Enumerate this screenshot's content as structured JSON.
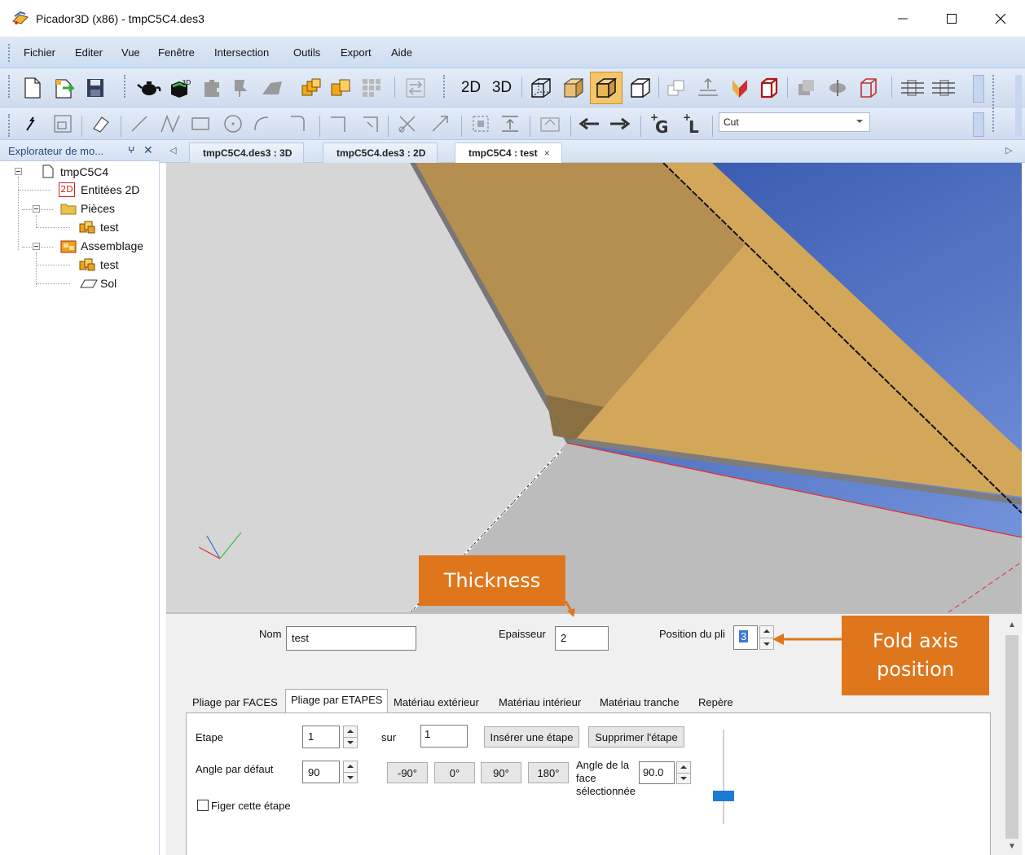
{
  "window": {
    "title": "Picador3D (x86) - tmpC5C4.des3"
  },
  "menu": {
    "items": [
      "Fichier",
      "Editer",
      "Vue",
      "Fenêtre",
      "Intersection",
      "Outils",
      "Export",
      "Aide"
    ]
  },
  "toolbar": {
    "label_2d": "2D",
    "label_3d": "3D",
    "cut_select_value": "Cut"
  },
  "explorer": {
    "title": "Explorateur de mo...",
    "pin": "ⵖ",
    "close": "✕",
    "tree": {
      "root": "tmpC5C4",
      "entities_badge": "2D",
      "entities": "Entitées 2D",
      "pieces": "Pièces",
      "piece_test": "test",
      "assemblage": "Assemblage",
      "assembly_test": "test",
      "sol": "Sol"
    }
  },
  "doc_tabs": {
    "items": [
      "tmpC5C4.des3 : 3D",
      "tmpC5C4.des3 : 2D",
      "tmpC5C4 : test"
    ],
    "active_index": 2,
    "close": "×"
  },
  "properties": {
    "nom_label": "Nom",
    "nom_value": "test",
    "epaisseur_label": "Epaisseur",
    "epaisseur_value": "2",
    "position_label": "Position du pli",
    "position_value": "3",
    "tabs": [
      "Pliage par FACES",
      "Pliage par ETAPES",
      "Matériau extérieur",
      "Matériau intérieur",
      "Matériau tranche",
      "Repère"
    ],
    "active_tab_index": 1,
    "etape_label": "Etape",
    "etape_value": "1",
    "sur_label": "sur",
    "sur_value": "1",
    "insert_button": "Insérer une étape",
    "delete_button": "Supprimer l'étape",
    "angle_defaut_label": "Angle par défaut",
    "angle_defaut_value": "90",
    "angle_buttons": [
      "-90°",
      "0°",
      "90°",
      "180°"
    ],
    "angle_face_label": "Angle de la face sélectionnée",
    "angle_face_value": "90.0",
    "figer_label": "Figer cette étape",
    "figer_checked": false
  },
  "annotations": {
    "thickness": "Thickness",
    "fold_axis": "Fold axis position"
  },
  "colors": {
    "callout": "#e0761c",
    "sheet_tan": "#d3a75a",
    "sheet_dark": "#b48f50",
    "sky_blue": "#2f58b8",
    "fold_line": "#e03030"
  }
}
